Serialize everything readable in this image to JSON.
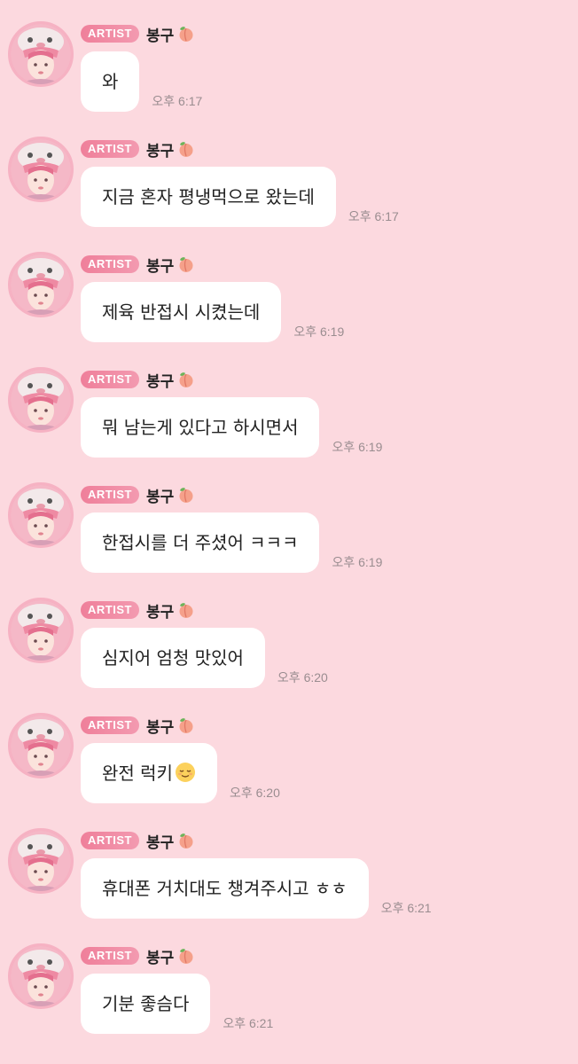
{
  "artist_badge": "ARTIST",
  "sender_name": "봉구",
  "sender_emoji": "peach-emoji",
  "colors": {
    "background": "#fcd9df",
    "bubble": "#ffffff",
    "badge": "#ef7f9a",
    "timestamp": "#9a8d90"
  },
  "messages": [
    {
      "text": "와",
      "time": "오후 6:17"
    },
    {
      "text": "지금 혼자 평냉먹으로 왔는데",
      "time": "오후 6:17"
    },
    {
      "text": "제육 반접시 시켰는데",
      "time": "오후 6:19"
    },
    {
      "text": "뭐 남는게 있다고 하시면서",
      "time": "오후 6:19"
    },
    {
      "text": "한접시를 더 주셨어 ㅋㅋㅋ",
      "time": "오후 6:19"
    },
    {
      "text": "심지어 엄청 맛있어",
      "time": "오후 6:20"
    },
    {
      "text": "완전 럭키",
      "emoji": "relieved-face-emoji",
      "time": "오후 6:20"
    },
    {
      "text": "휴대폰 거치대도 챙겨주시고 ㅎㅎ",
      "time": "오후 6:21"
    },
    {
      "text": "기분 좋슴다",
      "time": "오후 6:21"
    }
  ]
}
